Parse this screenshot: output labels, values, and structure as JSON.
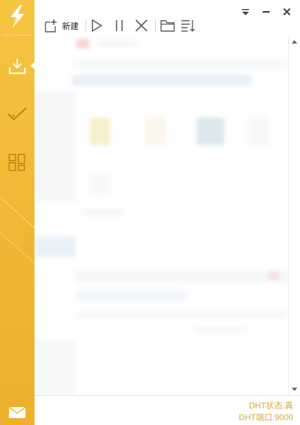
{
  "toolbar": {
    "new_label": "新建"
  },
  "status": {
    "dht_state": "DHT状态:真",
    "dht_port": "DHT端口:9000"
  },
  "colors": {
    "sidebar": "#f0b732",
    "status_text": "#d8a83a",
    "icon_stroke": "#555555"
  },
  "icons": [
    "logo-bolt-icon",
    "download-icon",
    "completed-check-icon",
    "grid-apps-icon",
    "mail-icon",
    "new-task-icon",
    "start-icon",
    "pause-icon",
    "delete-icon",
    "open-folder-icon",
    "sort-icon",
    "dropdown-icon",
    "minimize-icon",
    "close-icon"
  ]
}
